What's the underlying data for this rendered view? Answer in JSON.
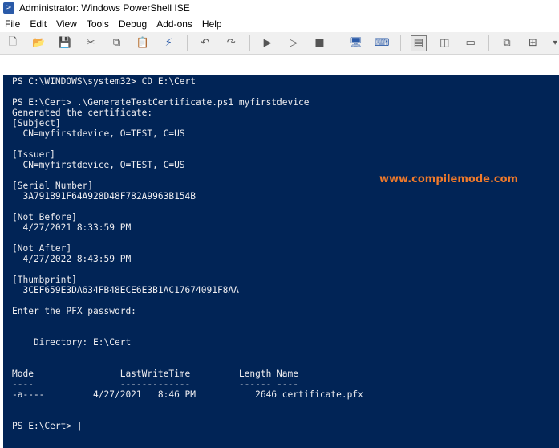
{
  "window": {
    "title": "Administrator: Windows PowerShell ISE",
    "icon": "powershell-icon"
  },
  "menu": [
    "File",
    "Edit",
    "View",
    "Tools",
    "Debug",
    "Add-ons",
    "Help"
  ],
  "toolbar": {
    "icons": [
      "new-icon",
      "open-icon",
      "save-icon",
      "cut-icon",
      "copy-icon",
      "paste-icon",
      "clear-icon",
      "undo-icon",
      "redo-icon",
      "run-icon",
      "run-selection-icon",
      "stop-icon",
      "remote-icon",
      "powershell-tab-icon",
      "layout-top-icon",
      "layout-right-icon",
      "layout-max-icon",
      "commands-icon",
      "expand-icon",
      "more-icon"
    ]
  },
  "console": {
    "lines": [
      "PS C:\\WINDOWS\\system32> CD E:\\Cert",
      "",
      "PS E:\\Cert> .\\GenerateTestCertificate.ps1 myfirstdevice",
      "Generated the certificate:",
      "[Subject]",
      "  CN=myfirstdevice, O=TEST, C=US",
      "",
      "[Issuer]",
      "  CN=myfirstdevice, O=TEST, C=US",
      "",
      "[Serial Number]",
      "  3A791B91F64A928D48F782A9963B154B",
      "",
      "[Not Before]",
      "  4/27/2021 8:33:59 PM",
      "",
      "[Not After]",
      "  4/27/2022 8:43:59 PM",
      "",
      "[Thumbprint]",
      "  3CEF659E3DA634FB48ECE6E3B1AC17674091F8AA",
      "",
      "Enter the PFX password:",
      "",
      "",
      "    Directory: E:\\Cert",
      "",
      "",
      "Mode                LastWriteTime         Length Name",
      "----                -------------         ------ ----",
      "-a----         4/27/2021   8:46 PM           2646 certificate.pfx",
      "",
      "",
      "PS E:\\Cert> |"
    ]
  },
  "watermark": "www.compilemode.com",
  "colors": {
    "console_bg": "#012456",
    "console_fg": "#eeedf0",
    "watermark": "#f07a2b"
  }
}
